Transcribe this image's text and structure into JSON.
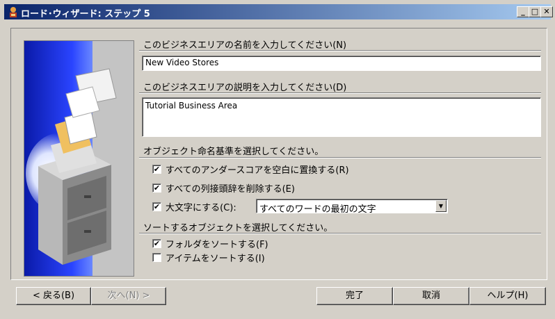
{
  "window": {
    "title": "ロード･ウィザード: ステップ 5",
    "controls": {
      "minimize": "_",
      "maximize": "□",
      "close": "✕"
    }
  },
  "business_area": {
    "name_label": "このビジネスエリアの名前を入力してください(N)",
    "name_value": "New Video Stores",
    "description_label": "このビジネスエリアの説明を入力してください(D)",
    "description_value": "Tutorial Business Area"
  },
  "naming": {
    "section_label": "オブジェクト命名基準を選択してください。",
    "options": [
      {
        "label": "すべてのアンダースコアを空白に置換する(R)",
        "checked": true,
        "mark": "✔"
      },
      {
        "label": "すべての列接頭辞を削除する(E)",
        "checked": true,
        "mark": "✔"
      },
      {
        "label": "大文字にする(C):",
        "checked": true,
        "mark": "✔"
      }
    ],
    "capitalize_select_value": "すべてのワードの最初の文字"
  },
  "sort": {
    "section_label": "ソートするオブジェクトを選択してください。",
    "options": [
      {
        "label": "フォルダをソートする(F)",
        "checked": true,
        "mark": "✔"
      },
      {
        "label": "アイテムをソートする(I)",
        "checked": false,
        "mark": ""
      }
    ]
  },
  "buttons": {
    "back": "< 戻る(B)",
    "next": "次へ(N) >",
    "finish": "完了",
    "cancel": "取消",
    "help": "ヘルプ(H)"
  },
  "colors": {
    "face": "#d4d0c8",
    "title_start": "#0a246a",
    "title_end": "#a6caf0",
    "illustration_blue": "#1c2fd8"
  },
  "icons": [
    "wizard-app-icon",
    "filing-cabinet-illustration",
    "chevron-down-icon"
  ]
}
